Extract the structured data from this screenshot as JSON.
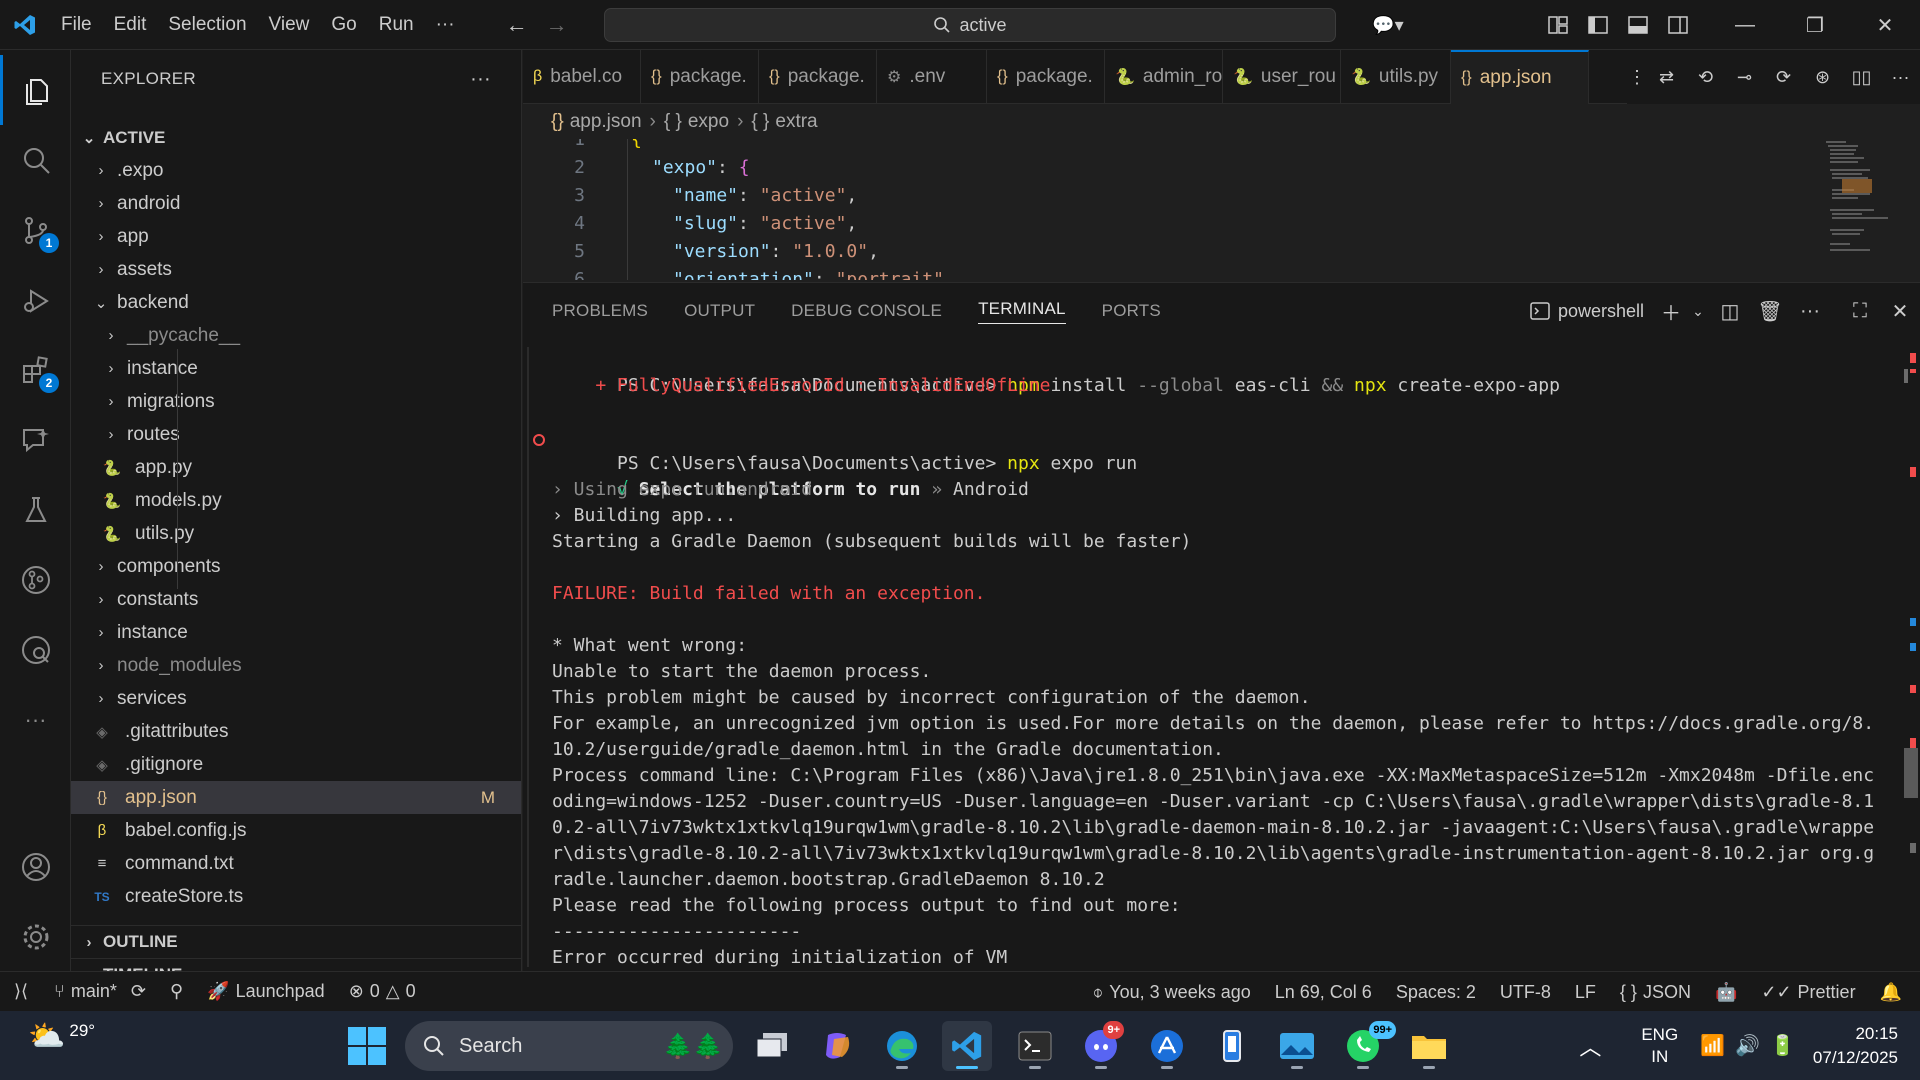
{
  "titlebar": {
    "menu": [
      "File",
      "Edit",
      "Selection",
      "View",
      "Go",
      "Run",
      "···"
    ],
    "search_text": "active"
  },
  "sidebar": {
    "title": "EXPLORER",
    "more": "···",
    "root": "ACTIVE",
    "items": [
      {
        "label": ".expo",
        "type": "folder",
        "level": 1
      },
      {
        "label": "android",
        "type": "folder",
        "level": 1
      },
      {
        "label": "app",
        "type": "folder",
        "level": 1
      },
      {
        "label": "assets",
        "type": "folder",
        "level": 1
      },
      {
        "label": "backend",
        "type": "folder-open",
        "level": 1
      },
      {
        "label": "__pycache__",
        "type": "folder",
        "level": 2,
        "muted": true
      },
      {
        "label": "instance",
        "type": "folder",
        "level": 2
      },
      {
        "label": "migrations",
        "type": "folder",
        "level": 2
      },
      {
        "label": "routes",
        "type": "folder",
        "level": 2
      },
      {
        "label": "app.py",
        "type": "python",
        "level": 2
      },
      {
        "label": "models.py",
        "type": "python",
        "level": 2
      },
      {
        "label": "utils.py",
        "type": "python",
        "level": 2
      },
      {
        "label": "components",
        "type": "folder",
        "level": 1
      },
      {
        "label": "constants",
        "type": "folder",
        "level": 1
      },
      {
        "label": "instance",
        "type": "folder",
        "level": 1
      },
      {
        "label": "node_modules",
        "type": "folder",
        "level": 1,
        "muted": true
      },
      {
        "label": "services",
        "type": "folder",
        "level": 1
      },
      {
        "label": ".gitattributes",
        "type": "git",
        "level": 1
      },
      {
        "label": ".gitignore",
        "type": "git",
        "level": 1
      },
      {
        "label": "app.json",
        "type": "json",
        "level": 1,
        "selected": true,
        "badge": "M"
      },
      {
        "label": "babel.config.js",
        "type": "babel",
        "level": 1
      },
      {
        "label": "command.txt",
        "type": "text",
        "level": 1
      },
      {
        "label": "createStore.ts",
        "type": "ts",
        "level": 1
      }
    ],
    "outline": "OUTLINE",
    "timeline": "TIMELINE"
  },
  "tabs": [
    {
      "label": "babel.co",
      "icon": "babel"
    },
    {
      "label": "package.",
      "icon": "json"
    },
    {
      "label": "package.",
      "icon": "json"
    },
    {
      "label": ".env",
      "icon": "gear"
    },
    {
      "label": "package.",
      "icon": "json"
    },
    {
      "label": "admin_ro",
      "icon": "python"
    },
    {
      "label": "user_rou",
      "icon": "python"
    },
    {
      "label": "utils.py",
      "icon": "python"
    },
    {
      "label": "app.json",
      "icon": "json",
      "active": true
    }
  ],
  "breadcrumb": [
    "app.json",
    "expo",
    "extra"
  ],
  "editor": {
    "lines": [
      {
        "n": "1",
        "text": "{"
      },
      {
        "n": "2",
        "key": "\"expo\"",
        "brace": "{"
      },
      {
        "n": "3",
        "key": "\"name\"",
        "value": "\"active\""
      },
      {
        "n": "4",
        "key": "\"slug\"",
        "value": "\"active\""
      },
      {
        "n": "5",
        "key": "\"version\"",
        "value": "\"1.0.0\""
      },
      {
        "n": "6",
        "key": "\"orientation\"",
        "value": "\"portrait\""
      }
    ]
  },
  "panel": {
    "tabs": [
      "PROBLEMS",
      "OUTPUT",
      "DEBUG CONSOLE",
      "TERMINAL",
      "PORTS"
    ],
    "active_tab": "TERMINAL",
    "shell": "powershell",
    "terminal": {
      "prompt1": "PS C:\\Users\\fausa\\Documents\\active>",
      "cmd1_a": "npm",
      "cmd1_b": "install",
      "cmd1_c": "--global",
      "cmd1_d": "eas-cli",
      "cmd1_e": "&&",
      "cmd1_f": "npx",
      "cmd1_g": "create-expo-app",
      "err1": "    + FullyQualifiedErrorId : InvalidEndOfLine",
      "prompt2": "PS C:\\Users\\fausa\\Documents\\active>",
      "cmd2_a": "npx",
      "cmd2_b": "expo run",
      "check": "√",
      "select": "Select the platform to run",
      "sel_sep": "»",
      "sel_val": "Android",
      "using": "› Using expo run:android",
      "building": "› Building app...",
      "starting": "Starting a Gradle Daemon (subsequent builds will be faster)",
      "failure": "FAILURE: Build failed with an exception.",
      "what": "* What went wrong:",
      "unable": "Unable to start the daemon process.",
      "problem": "This problem might be caused by incorrect configuration of the daemon.",
      "example1": "For example, an unrecognized jvm option is used.For more details on the daemon, please refer to https://docs.gradle.org/8.",
      "example2": "10.2/userguide/gradle_daemon.html in the Gradle documentation.",
      "proc1": "Process command line: C:\\Program Files (x86)\\Java\\jre1.8.0_251\\bin\\java.exe -XX:MaxMetaspaceSize=512m -Xmx2048m -Dfile.enc",
      "proc2": "oding=windows-1252 -Duser.country=US -Duser.language=en -Duser.variant -cp C:\\Users\\fausa\\.gradle\\wrapper\\dists\\gradle-8.1",
      "proc3": "0.2-all\\7iv73wktx1xtkvlq19urqw1wm\\gradle-8.10.2\\lib\\gradle-daemon-main-8.10.2.jar -javaagent:C:\\Users\\fausa\\.gradle\\wrappe",
      "proc4": "r\\dists\\gradle-8.10.2-all\\7iv73wktx1xtkvlq19urqw1wm\\gradle-8.10.2\\lib\\agents\\gradle-instrumentation-agent-8.10.2.jar org.g",
      "proc5": "radle.launcher.daemon.bootstrap.GradleDaemon 8.10.2",
      "please": "Please read the following process output to find out more:",
      "dashes": "-----------------------",
      "vmerr": "Error occurred during initialization of VM"
    }
  },
  "statusbar": {
    "branch": "main*",
    "launchpad": "Launchpad",
    "errors": "0",
    "warnings": "0",
    "blame": "You, 3 weeks ago",
    "position": "Ln 69, Col 6",
    "spaces": "Spaces: 2",
    "encoding": "UTF-8",
    "eol": "LF",
    "language": "JSON",
    "prettier": "Prettier"
  },
  "activity_badges": {
    "scm": "1",
    "extensions": "2"
  },
  "taskbar": {
    "temperature": "29°",
    "search": "Search",
    "discord_badge": "9+",
    "whatsapp_badge": "99+",
    "lang1": "ENG",
    "lang2": "IN",
    "time": "20:15",
    "date": "07/12/2025"
  },
  "colors": {
    "accent": "#0078d4",
    "error": "#f14c4c",
    "command": "#e5e510",
    "modified": "#e2c08d"
  }
}
